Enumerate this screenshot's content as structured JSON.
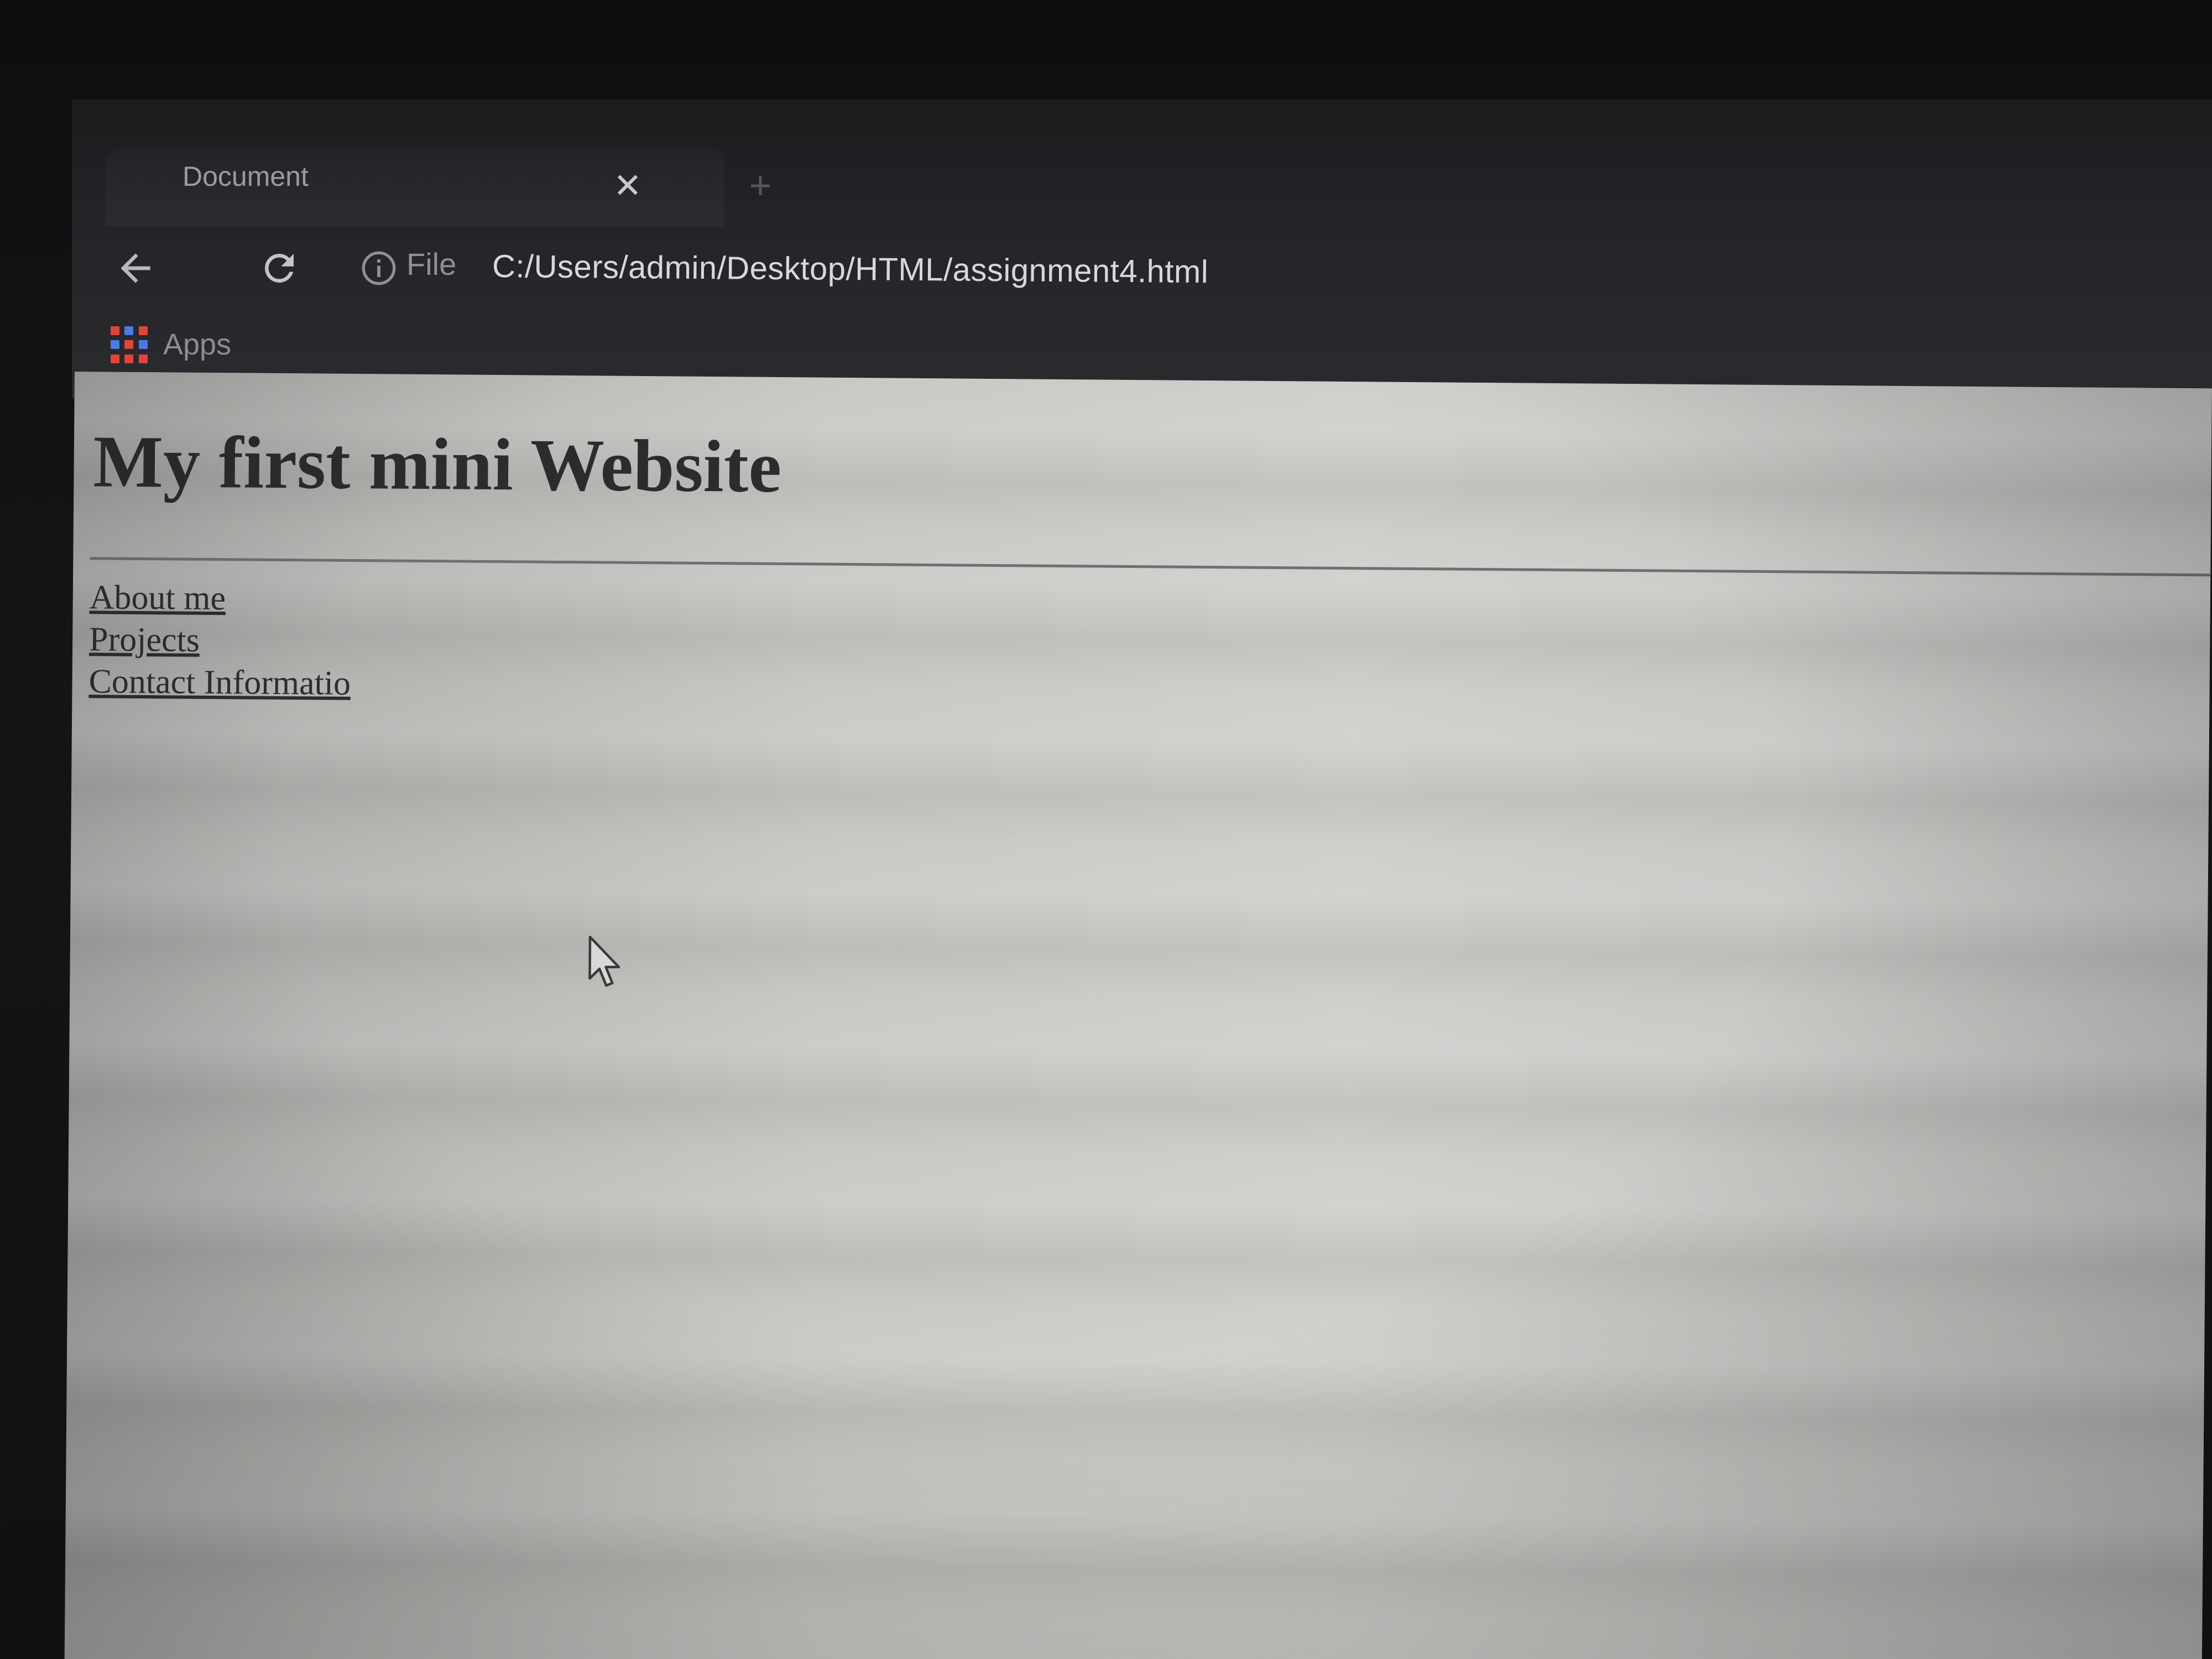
{
  "tab": {
    "title": "Document",
    "close_glyph": "✕",
    "new_tab_glyph": "+"
  },
  "toolbar": {
    "back_icon": "arrow-left-icon",
    "reload_icon": "reload-icon",
    "info_icon": "info-icon",
    "scheme_label": "File",
    "url": "C:/Users/admin/Desktop/HTML/assignment4.html"
  },
  "bookmarks": {
    "apps_label": "Apps",
    "apps_icon": "apps-grid-icon",
    "apps_colors": [
      "#e0453a",
      "#4a7be5",
      "#e0453a",
      "#4a7be5",
      "#e0453a",
      "#4a7be5",
      "#e0453a",
      "#e0453a",
      "#e0453a"
    ]
  },
  "page": {
    "heading": "My first mini Website",
    "links": [
      {
        "label": "About me"
      },
      {
        "label": "Projects"
      },
      {
        "label": "Contact Informatio"
      }
    ]
  },
  "colors": {
    "chrome_background": "#242528",
    "page_background": "#c8c8c5",
    "text": "#2b2c2d"
  }
}
